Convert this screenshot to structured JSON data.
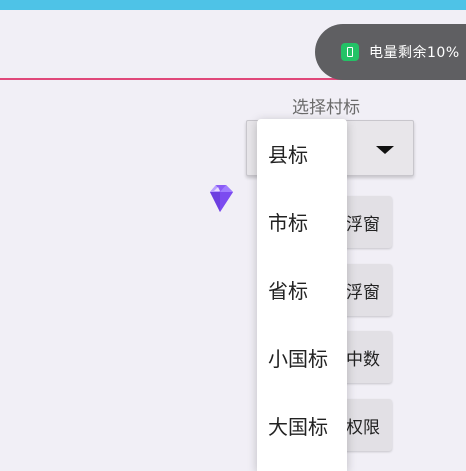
{
  "toast": {
    "icon": "battery-icon",
    "text": "电量剩余10%",
    "accent": "#23c266"
  },
  "selector": {
    "label": "选择村标",
    "selected": ""
  },
  "dropdown_options": [
    "县标",
    "市标",
    "省标",
    "小国标",
    "大国标"
  ],
  "buttons": {
    "float_window_1": "浮窗",
    "float_window_2": "浮窗",
    "count": "中数",
    "permission": "权限"
  },
  "colors": {
    "top_strip": "#4ec3e7",
    "appbar_line": "#e0487a",
    "gem": "#8b5cf6"
  }
}
